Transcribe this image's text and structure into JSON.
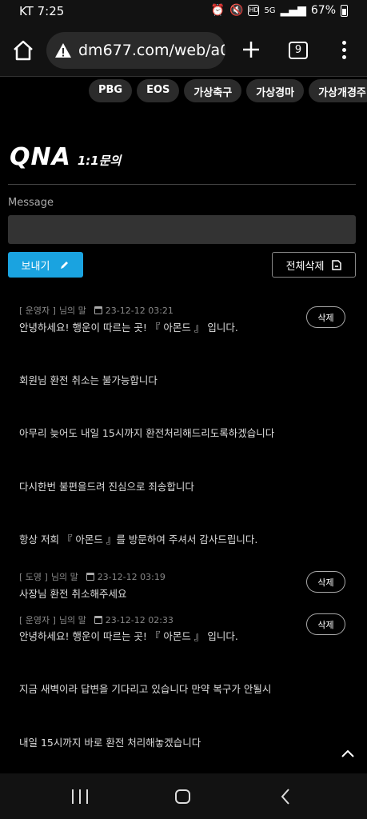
{
  "status": {
    "time": "KT 7:25",
    "network": "5G",
    "battery": "67%"
  },
  "browser": {
    "url": "dm677.com/web/a0",
    "tab_count": "9"
  },
  "nav_chips": [
    "PBG",
    "EOS",
    "가상축구",
    "가상경마",
    "가상개경주"
  ],
  "page": {
    "title": "QNA",
    "subtitle": "1:1문의",
    "message_label": "Message",
    "message_placeholder": "",
    "send_label": "보내기",
    "delete_all_label": "전체삭제"
  },
  "entries": [
    {
      "author": "[ 운영자 ]",
      "suffix": "님의 말",
      "date": "23-12-12 03:21",
      "delete_label": "삭제",
      "lines": [
        "안녕하세요! 행운이 따르는 곳! 『 아몬드 』 입니다.",
        "회원님 환전 취소는 불가능합니다",
        "아무리 늦어도 내일 15시까지 환전처리해드리도록하겠습니다",
        "다시한번 불편을드려 진심으로 죄송합니다",
        "항상 저희 『 아몬드 』를 방문하여 주셔서 감사드립니다."
      ]
    },
    {
      "author": "[ 도영 ]",
      "suffix": "님의 말",
      "date": "23-12-12 03:19",
      "delete_label": "삭제",
      "lines": [
        "사장님 환전 취소해주세요"
      ]
    },
    {
      "author": "[ 운영자 ]",
      "suffix": "님의 말",
      "date": "23-12-12 02:33",
      "delete_label": "삭제",
      "lines": [
        "안녕하세요! 행운이 따르는 곳! 『 아몬드 』 입니다.",
        "지금 새벽이라 답변을 기다리고 있습니다 만약 복구가 안될시",
        "내일 15시까지 바로 환전 처리해놓겠습니다"
      ]
    }
  ],
  "colors": {
    "accent": "#1aa3e0",
    "background": "#000000"
  }
}
